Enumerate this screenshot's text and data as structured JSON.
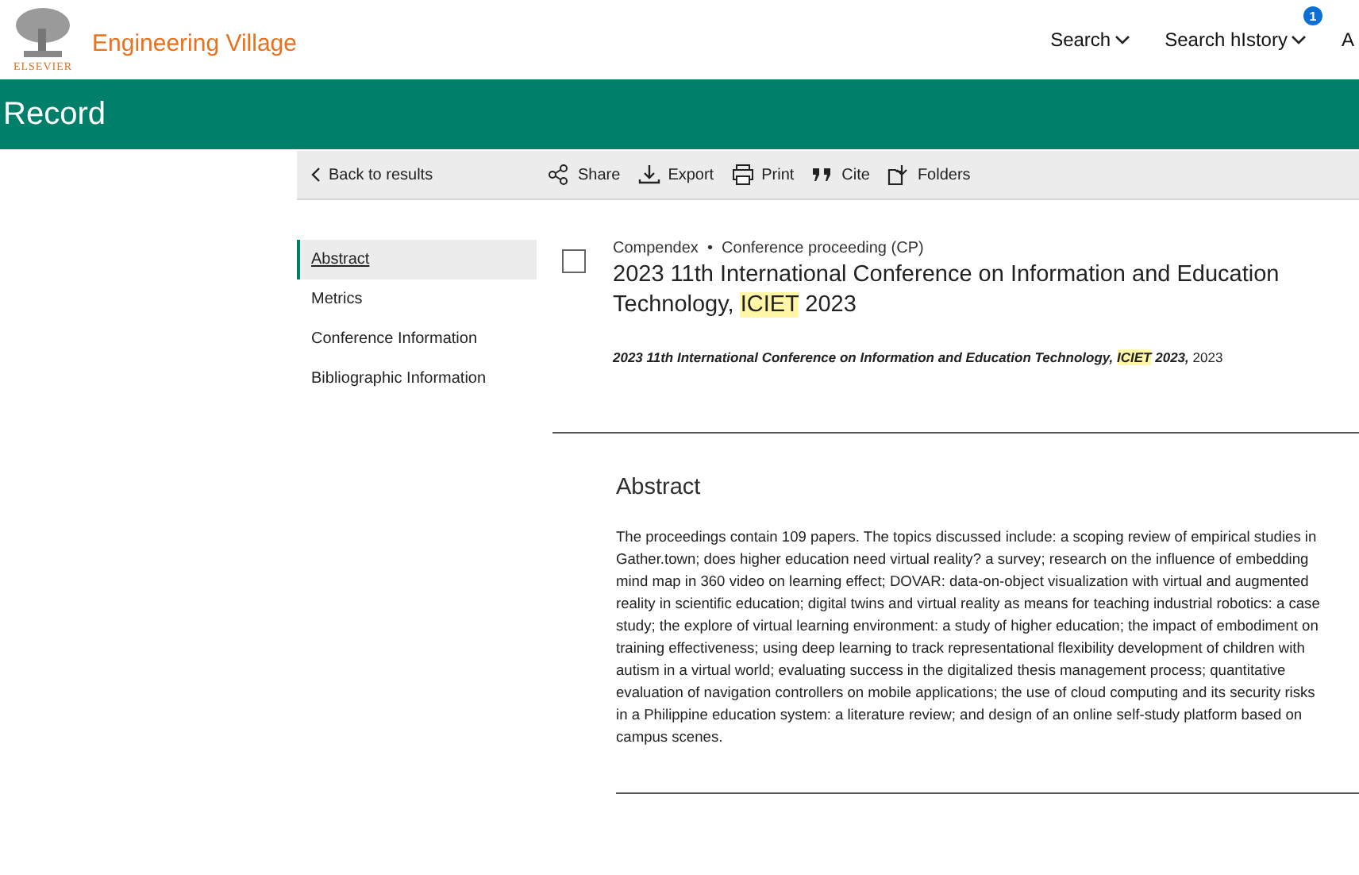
{
  "header": {
    "logo_text": "ELSEVIER",
    "product": "Engineering Village",
    "nav": [
      {
        "label": "Search"
      },
      {
        "label": "Search hIstory",
        "badge": "1"
      },
      {
        "label": "A"
      }
    ]
  },
  "page_title": "Record",
  "toolbar": {
    "back": "Back to results",
    "actions": [
      {
        "kind": "share",
        "label": "Share"
      },
      {
        "kind": "export",
        "label": "Export"
      },
      {
        "kind": "print",
        "label": "Print"
      },
      {
        "kind": "cite",
        "label": "Cite"
      },
      {
        "kind": "folders",
        "label": "Folders"
      }
    ]
  },
  "sidebar": {
    "items": [
      {
        "label": "Abstract",
        "selected": true
      },
      {
        "label": "Metrics",
        "selected": false
      },
      {
        "label": "Conference Information",
        "selected": false
      },
      {
        "label": "Bibliographic Information",
        "selected": false
      }
    ]
  },
  "record": {
    "checked": false,
    "database": "Compendex",
    "separator": "•",
    "doc_type": "Conference proceeding (CP)",
    "title_parts": [
      {
        "text": "2023 11th International Conference on Information and Education Technology, ",
        "highlighted": false
      },
      {
        "text": "ICIET",
        "highlighted": true
      },
      {
        "text": " 2023",
        "highlighted": false
      }
    ],
    "citation_parts": [
      {
        "text": "2023 11th International Conference on Information and Education Technology, ",
        "highlighted": false,
        "emphasis": true
      },
      {
        "text": "ICIET",
        "highlighted": true,
        "emphasis": true
      },
      {
        "text": " 2023,",
        "highlighted": false,
        "emphasis": true
      },
      {
        "text": " 2023",
        "highlighted": false,
        "emphasis": false
      }
    ]
  },
  "abstract": {
    "heading": "Abstract",
    "text": "The proceedings contain 109 papers. The topics discussed include: a scoping review of empirical studies in Gather.town; does higher education need virtual reality? a survey; research on the influence of embedding mind map in 360 video on learning effect; DOVAR: data-on-object visualization with virtual and augmented reality in scientific education; digital twins and virtual reality as means for teaching industrial robotics: a case study; the explore of virtual learning environment: a study of higher education; the impact of embodiment on training effectiveness; using deep learning to track representational flexibility development of children with autism in a virtual world; evaluating success in the digitalized thesis management process; quantitative evaluation of navigation controllers on mobile applications; the use of cloud computing and its security risks in a Philippine education system: a literature review; and design of an online self-study platform based on campus scenes."
  }
}
